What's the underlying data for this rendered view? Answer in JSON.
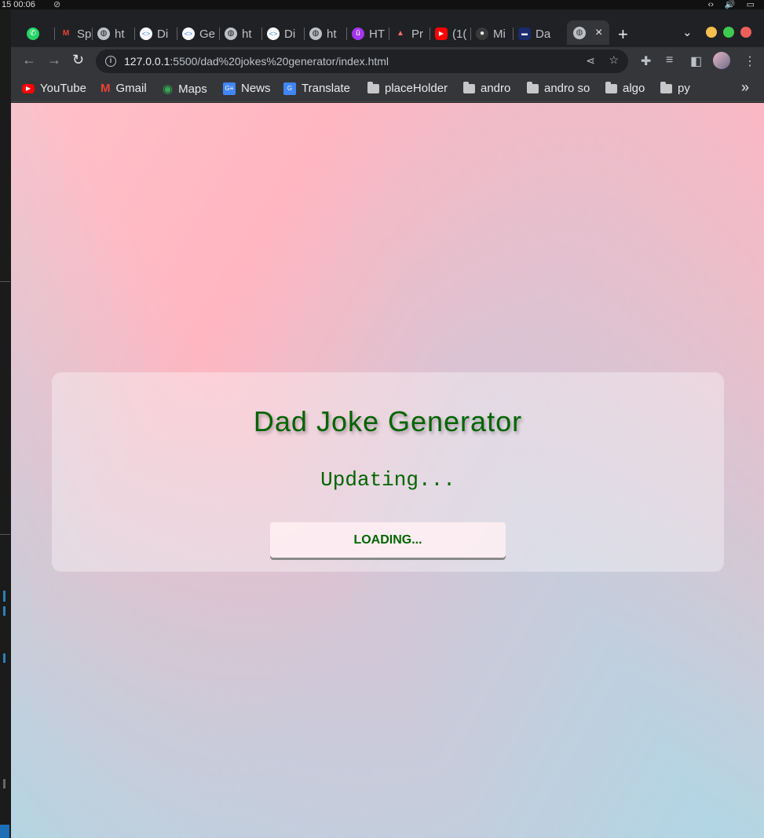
{
  "os": {
    "clock": "15 00:06"
  },
  "tabs": [
    {
      "label": "",
      "icon": "whatsapp-icon"
    },
    {
      "label": "Sp",
      "icon": "gmail-icon"
    },
    {
      "label": "ht",
      "icon": "globe-icon"
    },
    {
      "label": "Di",
      "icon": "code-icon"
    },
    {
      "label": "Ge",
      "icon": "code-icon"
    },
    {
      "label": "ht",
      "icon": "globe-icon"
    },
    {
      "label": "Di",
      "icon": "code-icon"
    },
    {
      "label": "ht",
      "icon": "globe-icon"
    },
    {
      "label": "HT",
      "icon": "udemy-icon"
    },
    {
      "label": "Pr",
      "icon": "rocket-icon"
    },
    {
      "label": "(1(",
      "icon": "youtube-icon"
    },
    {
      "label": "Mi",
      "icon": "github-icon"
    },
    {
      "label": "Da",
      "icon": "app-icon"
    }
  ],
  "active_tab": {
    "label": "",
    "icon": "globe-icon",
    "close": "×"
  },
  "new_tab_label": "+",
  "address": {
    "host": "127.0.0.1",
    "path": ":5500/dad%20jokes%20generator/index.html"
  },
  "bookmarks": [
    {
      "label": "YouTube",
      "icon": "youtube-icon"
    },
    {
      "label": "Gmail",
      "icon": "gmail-icon"
    },
    {
      "label": "Maps",
      "icon": "maps-icon"
    },
    {
      "label": "News",
      "icon": "news-icon"
    },
    {
      "label": "Translate",
      "icon": "translate-icon"
    },
    {
      "label": "placeHolder",
      "icon": "folder-icon"
    },
    {
      "label": "andro",
      "icon": "folder-icon"
    },
    {
      "label": "andro so",
      "icon": "folder-icon"
    },
    {
      "label": "algo",
      "icon": "folder-icon"
    },
    {
      "label": "py",
      "icon": "folder-icon"
    }
  ],
  "bookmarks_overflow": "»",
  "page": {
    "title": "Dad Joke Generator",
    "joke": "Updating...",
    "button_label": "LOADING..."
  },
  "colors": {
    "title": "#006400",
    "gradient_pink": "#ffb6c1",
    "gradient_blue": "#add8e6"
  }
}
